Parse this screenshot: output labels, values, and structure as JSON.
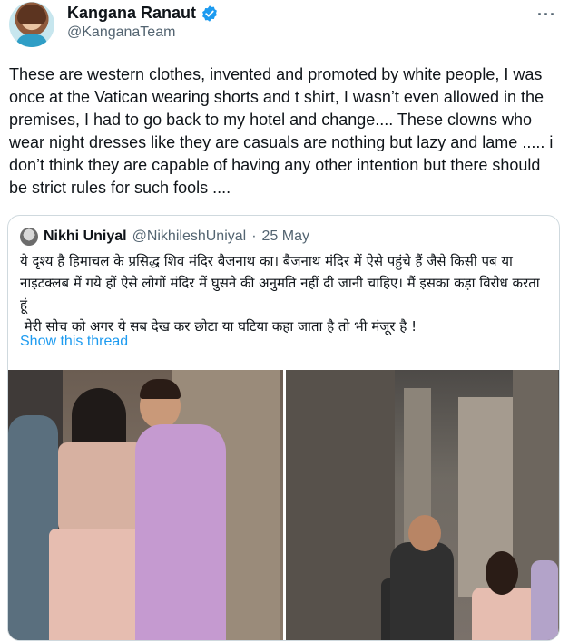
{
  "author": {
    "name": "Kangana Ranaut",
    "handle": "@KanganaTeam",
    "more_icon": "···"
  },
  "tweet": {
    "text": "These are western clothes, invented and promoted by white people, I was once at the Vatican wearing shorts and t shirt, I wasn’t even allowed in the premises, I had to go back to my hotel and change.... These clowns who wear night dresses like they are casuals are nothing but lazy and lame ..... i don’t think they are capable of having any other intention but there should be strict rules for such fools ...."
  },
  "quoted": {
    "name": "Nikhi Uniyal",
    "handle": "@NikhileshUniyal",
    "separator": "·",
    "date": "25 May",
    "text": "ये दृश्य है हिमाचल के प्रसिद्ध शिव मंदिर बैजनाथ का। बैजनाथ मंदिर में ऐसे पहुंचे हैं जैसे किसी पब या नाइटक्लब में गये हों ऐसे लोगों मंदिर में घुसने की अनुमति नहीं दी जानी चाहिए। मैं इसका कड़ा विरोध करता हूं\n मेरी सोच को अगर ये सब देख कर छोटा या घटिया कहा जाता है तो भी मंजूर है !",
    "show_thread": "Show this thread"
  },
  "colors": {
    "link": "#1d9bf0",
    "verified": "#1d9bf0",
    "secondary_text": "#536471",
    "border": "#cfd9de"
  }
}
